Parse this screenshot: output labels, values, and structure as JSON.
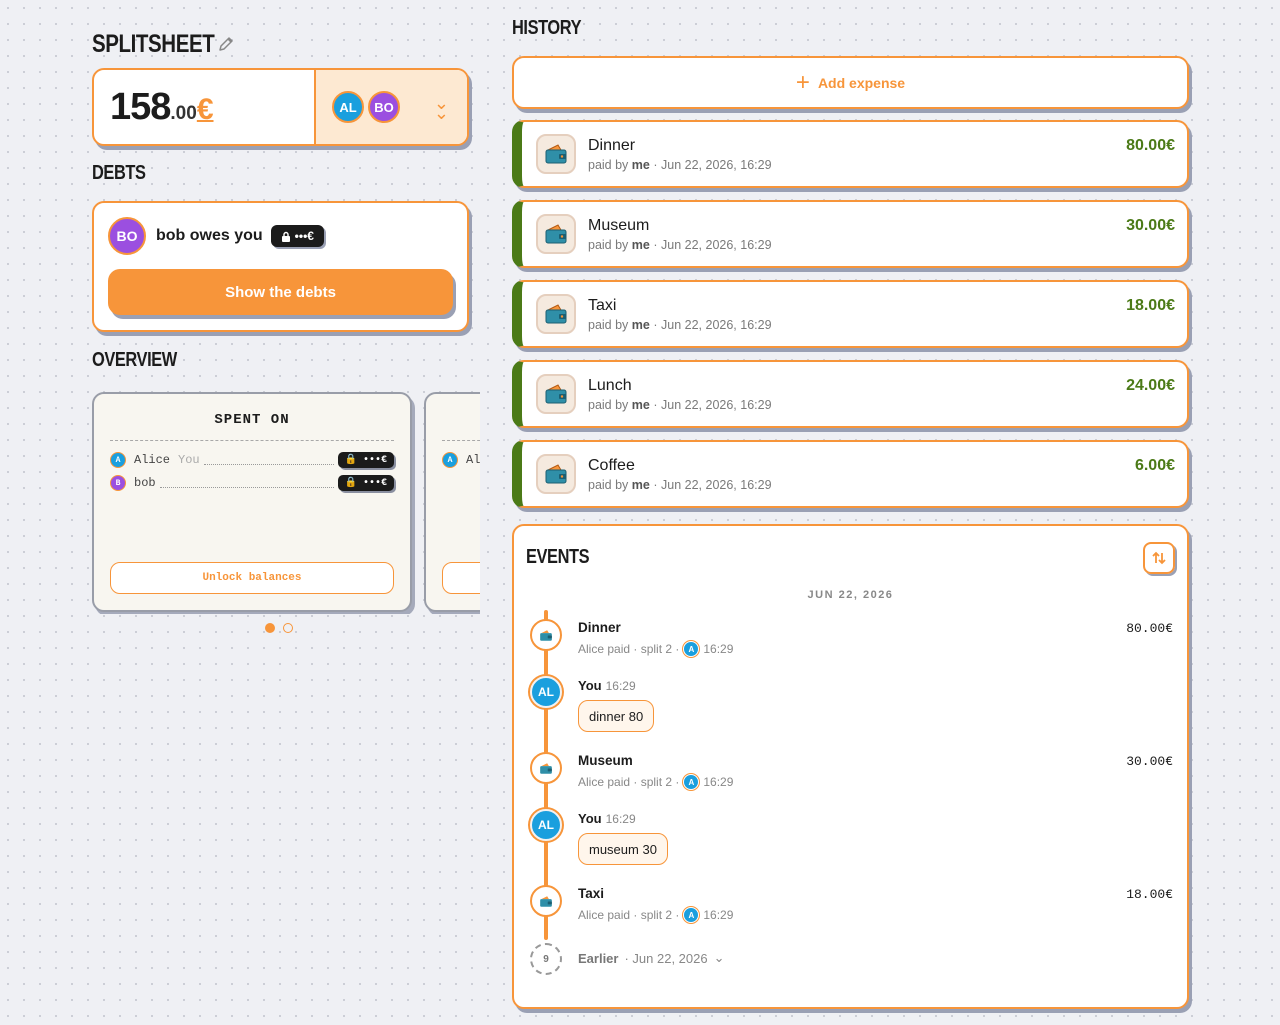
{
  "app": {
    "title": "SPLITSHEET"
  },
  "total": {
    "integer": "158",
    "decimal": ".00",
    "currency": "€"
  },
  "members": [
    {
      "initials": "AL",
      "color": "#1a9fde"
    },
    {
      "initials": "BO",
      "color": "#9b4fe0"
    }
  ],
  "debts": {
    "label": "DEBTS",
    "item": {
      "initials": "BO",
      "text": "bob owes you",
      "locked_amount": "•••€"
    },
    "show_button": "Show the debts"
  },
  "overview": {
    "label": "OVERVIEW",
    "card": {
      "title": "SPENT ON",
      "rows": [
        {
          "badge": "A",
          "name": "Alice",
          "tag": "You",
          "amount": "•••€"
        },
        {
          "badge": "B",
          "name": "bob",
          "tag": "",
          "amount": "•••€"
        }
      ],
      "unlock": "Unlock balances"
    },
    "peek_row": "Al"
  },
  "history": {
    "label": "HISTORY",
    "add_expense": "Add expense",
    "expenses": [
      {
        "name": "Dinner",
        "payer": "me",
        "date": "Jun 22, 2026, 16:29",
        "amount": "80.00€"
      },
      {
        "name": "Museum",
        "payer": "me",
        "date": "Jun 22, 2026, 16:29",
        "amount": "30.00€"
      },
      {
        "name": "Taxi",
        "payer": "me",
        "date": "Jun 22, 2026, 16:29",
        "amount": "18.00€"
      },
      {
        "name": "Lunch",
        "payer": "me",
        "date": "Jun 22, 2026, 16:29",
        "amount": "24.00€"
      },
      {
        "name": "Coffee",
        "payer": "me",
        "date": "Jun 22, 2026, 16:29",
        "amount": "6.00€"
      }
    ],
    "paid_by_prefix": "paid by",
    "separator": "·"
  },
  "events": {
    "label": "EVENTS",
    "date": "JUN 22, 2026",
    "items": [
      {
        "type": "expense",
        "title": "Dinner",
        "sub": "Alice paid · split 2 ·",
        "badge": "A",
        "time": "16:29",
        "amount": "80.00€"
      },
      {
        "type": "comment",
        "author": "You",
        "time": "16:29",
        "text": "dinner 80",
        "avatar": "AL"
      },
      {
        "type": "expense",
        "title": "Museum",
        "sub": "Alice paid · split 2 ·",
        "badge": "A",
        "time": "16:29",
        "amount": "30.00€"
      },
      {
        "type": "comment",
        "author": "You",
        "time": "16:29",
        "text": "museum 30",
        "avatar": "AL"
      },
      {
        "type": "expense",
        "title": "Taxi",
        "sub": "Alice paid · split 2 ·",
        "badge": "A",
        "time": "16:29",
        "amount": "18.00€"
      }
    ],
    "earlier": {
      "count": "9",
      "label": "Earlier",
      "date": "· Jun 22, 2026"
    }
  },
  "colors": {
    "accent": "#f7953a",
    "positive": "#4b7a17",
    "dark": "#1b1b1b"
  }
}
